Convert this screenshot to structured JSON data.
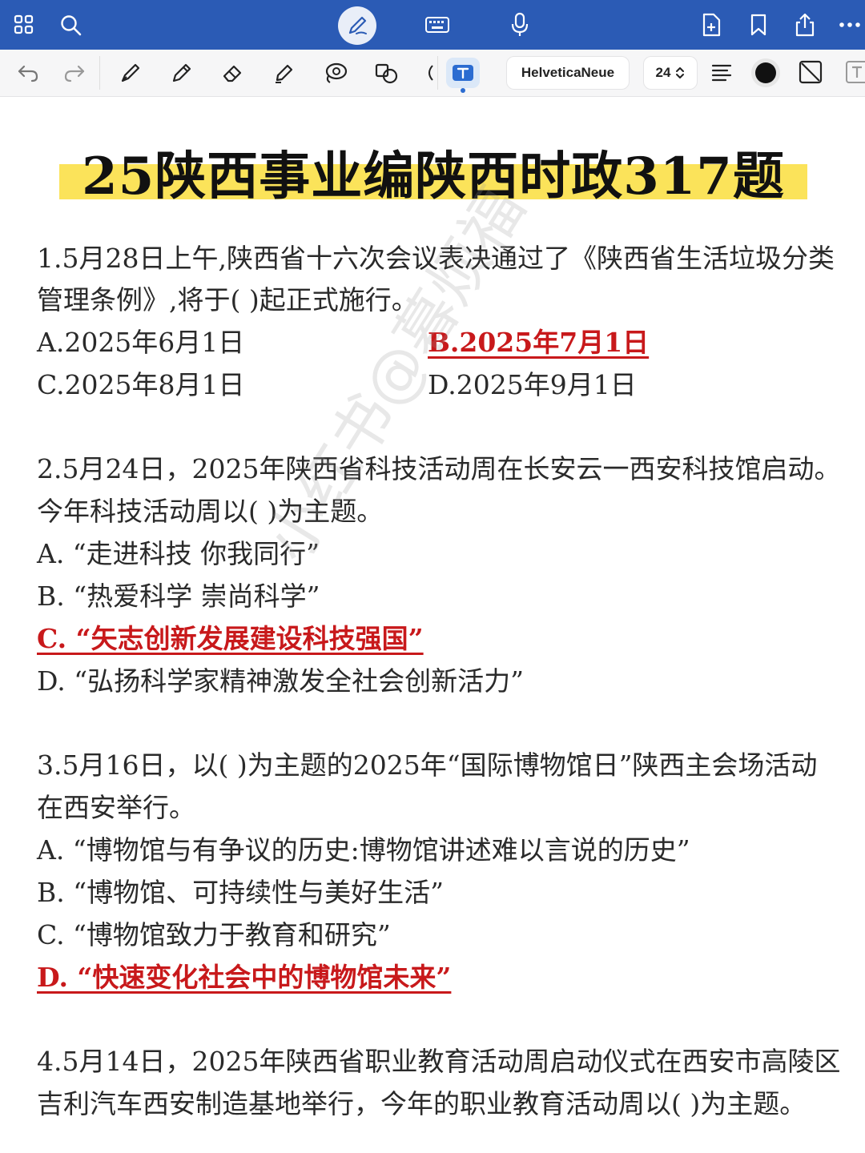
{
  "toolbar": {
    "font_name": "HelveticaNeue",
    "font_size": "24"
  },
  "document": {
    "title": "25陕西事业编陕西时政317题",
    "questions": [
      {
        "stem_lines": [
          "1.5月28日上午,陕西省十六次会议表决通过了《陕西省生活垃圾分类",
          "管理条例》,将于( )起正式施行。"
        ],
        "options": [
          "A.2025年6月1日",
          "B.2025年7月1日",
          "C.2025年8月1日",
          "D.2025年9月1日"
        ],
        "answer_index": 1
      },
      {
        "stem_lines": [
          "2.5月24日，2025年陕西省科技活动周在长安云一西安科技馆启动。",
          "今年科技活动周以( )为主题。"
        ],
        "options": [
          "A. “走进科技 你我同行”",
          "B. “热爱科学 崇尚科学”",
          "C. “矢志创新发展建设科技强国”",
          "D. “弘扬科学家精神激发全社会创新活力”"
        ],
        "answer_index": 2
      },
      {
        "stem_lines": [
          "3.5月16日，以( )为主题的2025年“国际博物馆日”陕西主会场活动",
          "在西安举行。"
        ],
        "options": [
          "A. “博物馆与有争议的历史:博物馆讲述难以言说的历史”",
          "B. “博物馆、可持续性与美好生活”",
          "C. “博物馆致力于教育和研究”",
          "D. “快速变化社会中的博物馆未来”"
        ],
        "answer_index": 3
      },
      {
        "stem_lines": [
          "4.5月14日，2025年陕西省职业教育活动周启动仪式在西安市高陵区",
          "吉利汽车西安制造基地举行，今年的职业教育活动周以( )为主题。"
        ]
      }
    ],
    "watermark": "小红书@暮烦福"
  },
  "colors": {
    "topbar": "#2b5bb5",
    "highlight": "#fbe35a",
    "answer": "#c8191b"
  }
}
